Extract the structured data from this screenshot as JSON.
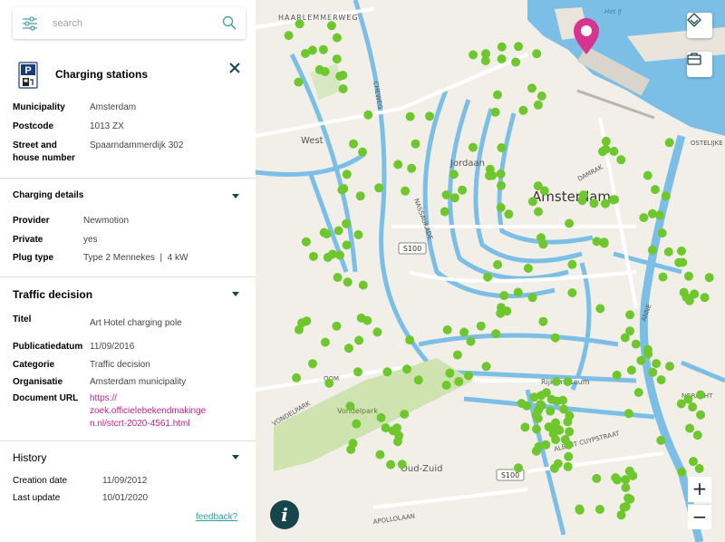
{
  "search": {
    "placeholder": "search",
    "filter_icon": "sliders-icon",
    "search_icon": "search-icon"
  },
  "header": {
    "title": "Charging stations",
    "icon": "parking-charging-icon",
    "close_icon": "close-icon"
  },
  "details": {
    "municipality_label": "Municipality",
    "municipality_value": "Amsterdam",
    "postcode_label": "Postcode",
    "postcode_value": "1013 ZX",
    "street_label_1": "Street and",
    "street_label_2": "house number",
    "street_value": "Spaarndammerdijk 302"
  },
  "charging": {
    "section_title": "Charging details",
    "provider_label": "Provider",
    "provider_value": "Newmotion",
    "private_label": "Private",
    "private_value": "yes",
    "plug_label": "Plug type",
    "plug_value": "Type 2 Mennekes  |  4 kW"
  },
  "traffic": {
    "section_title": "Traffic decision",
    "titel_label": "Titel",
    "titel_value": "Art Hotel charging pole",
    "date_label": "Publicatiedatum",
    "date_value": "11/09/2016",
    "category_label": "Categorie",
    "category_value": "Traffic decision",
    "org_label": "Organisatie",
    "org_value": "Amsterdam municipality",
    "url_label": "Document URL",
    "url_line1": "https://",
    "url_line2": "zoek.officielebekendmakinge",
    "url_line3": "n.nl/stcrt-2020-4561.html"
  },
  "history": {
    "section_title": "History",
    "creation_label": "Creation date",
    "creation_value": "11/09/2012",
    "update_label": "Last update",
    "update_value": "10/01/2020"
  },
  "feedback": "feedback?",
  "map": {
    "labels": {
      "haarlemmerweg": "HAARLEMMERWEG",
      "het_ij": "Het IJ",
      "west": "West",
      "jordaan": "Jordaan",
      "amsterdam": "Amsterdam",
      "damrak": "DAMRAK",
      "nassaukade": "NASSAUKADE",
      "s100_a": "S100",
      "s100_b": "S100",
      "rijksmuseum": "Rijksmuseum",
      "vondelpark": "Vondelpark",
      "oud_zuid": "Oud-Zuid",
      "albert_cuyp": "ALBERT CUYPSTRAAT",
      "apollolaan": "APOLLOLAAN",
      "vondelpark_road": "VONDELPARK",
      "ngracht": "NGRACHT",
      "ostelijke": "OSTELIJKE",
      "anne": "ANNE",
      "cheweg": "CHEWEG",
      "oom": "OOM"
    },
    "zoom_in": "+",
    "zoom_out": "−",
    "info": "i",
    "layers_icon": "layers-icon",
    "toolbox_icon": "briefcase-icon",
    "pin_icon": "location-pin-icon",
    "colors": {
      "marker": "#6ec72d",
      "water": "#7bbfe6",
      "pin": "#d6348e",
      "park": "#cfe3b0",
      "road": "#ffffff"
    }
  }
}
